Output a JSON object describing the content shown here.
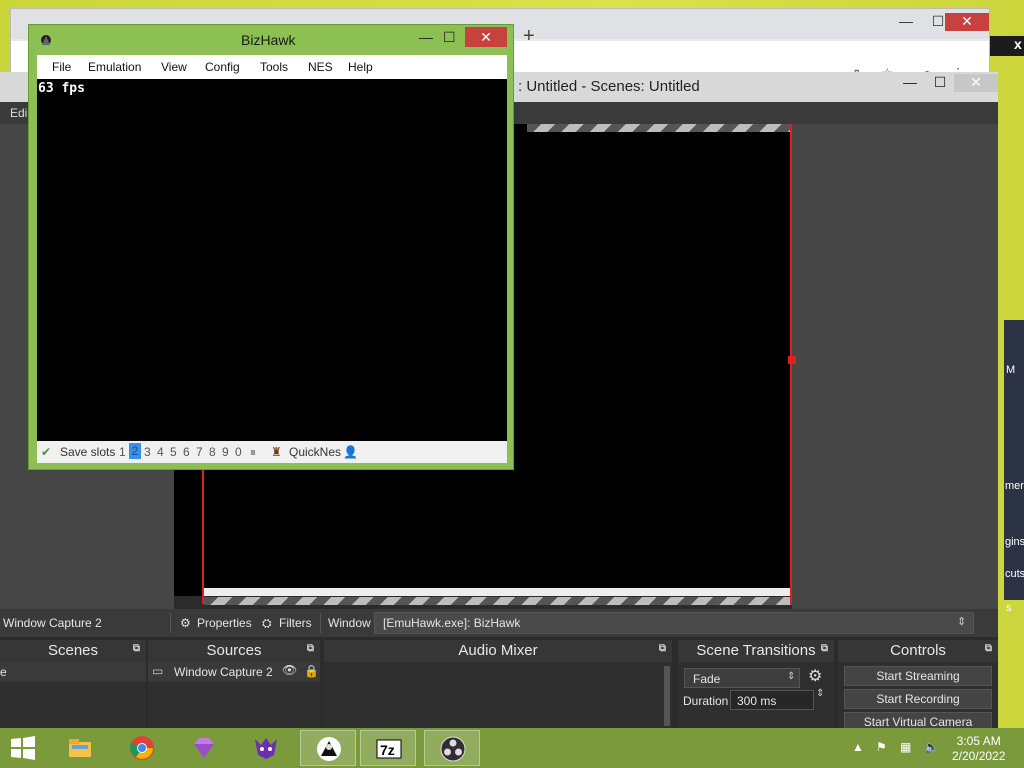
{
  "browser": {
    "new_tab": "+",
    "min": "—",
    "max": "☐",
    "close": "✕",
    "edge_char": "x"
  },
  "obs": {
    "title": ": Untitled - Scenes: Untitled",
    "menu_fragment": "Edi",
    "source_toolbar": {
      "source_name": "Window Capture 2",
      "properties": "Properties",
      "filters": "Filters",
      "window_label": "Window",
      "window_value": "[EmuHawk.exe]: BizHawk"
    },
    "docks": {
      "scenes": {
        "title": "Scenes",
        "item": "e"
      },
      "sources": {
        "title": "Sources",
        "item": "Window Capture 2"
      },
      "audio_mixer": {
        "title": "Audio Mixer"
      },
      "scene_transitions": {
        "title": "Scene Transitions",
        "transition": "Fade",
        "duration_label": "Duration",
        "duration_value": "300 ms"
      },
      "controls": {
        "title": "Controls",
        "start_streaming": "Start Streaming",
        "start_recording": "Start Recording",
        "start_virtual_camera": "Start Virtual Camera"
      }
    },
    "side_fragments": [
      "M",
      "mer",
      "gins",
      "cuts",
      "s"
    ]
  },
  "bizhawk": {
    "title": "BizHawk",
    "menu": [
      "File",
      "Emulation",
      "View",
      "Config",
      "Tools",
      "NES",
      "Help"
    ],
    "fps": "63 fps",
    "status": {
      "save_slots_label": "Save slots",
      "slots": [
        "1",
        "2",
        "3",
        "4",
        "5",
        "6",
        "7",
        "8",
        "9",
        "0"
      ],
      "selected_slot": "2",
      "core": "QuickNes"
    }
  },
  "taskbar": {
    "time": "3:05 AM",
    "date": "2/20/2022",
    "apps": [
      "start",
      "file-explorer",
      "chrome",
      "gem-app",
      "mask-app",
      "anonymous-app",
      "7zip",
      "obs"
    ]
  }
}
